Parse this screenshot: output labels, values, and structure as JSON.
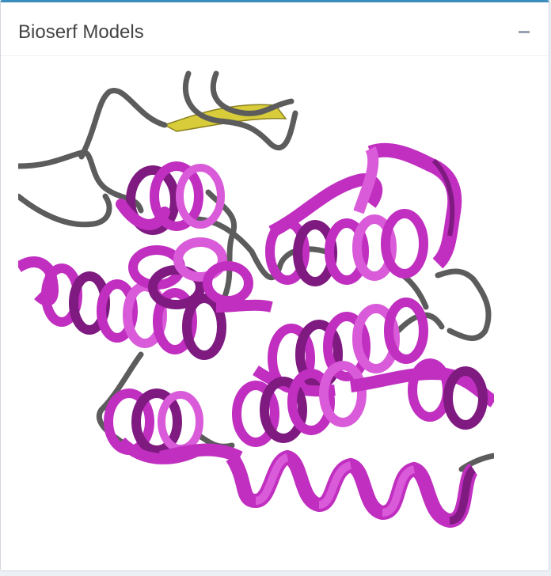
{
  "panel": {
    "title": "Bioserf Models",
    "collapse_icon": "minus-icon"
  },
  "viewer": {
    "content": "protein-structure-ribbon",
    "colors": {
      "helix": "#c02fc0",
      "helix_light": "#d95bd9",
      "helix_dark": "#7e1a80",
      "coil": "#5c5c5c",
      "strand": "#d8cc3a"
    }
  },
  "accent_color": "#3c8dbc"
}
